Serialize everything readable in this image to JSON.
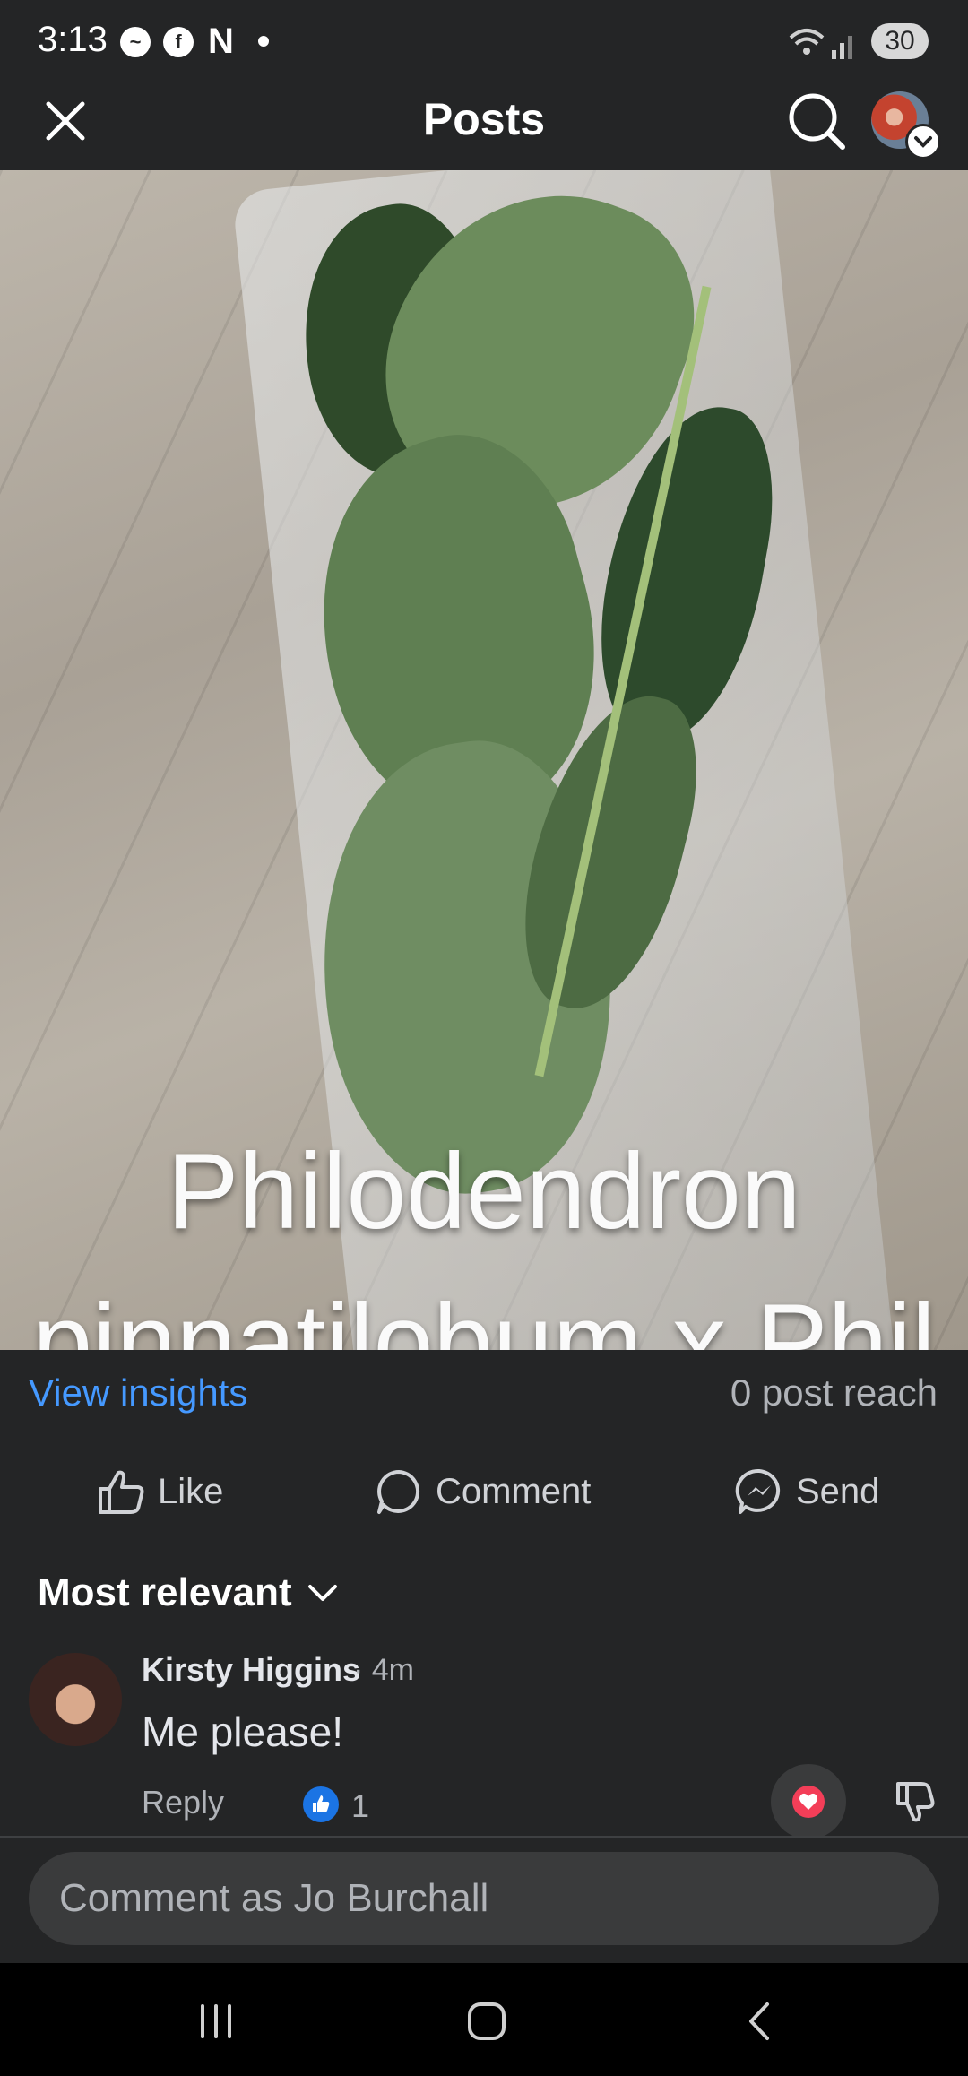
{
  "status_bar": {
    "time": "3:13",
    "battery": "30",
    "app_icons": [
      "messenger-icon",
      "facebook-icon",
      "netflix-icon",
      "dot-icon"
    ]
  },
  "header": {
    "title": "Posts",
    "close_icon": "close-icon",
    "search_icon": "search-icon"
  },
  "photo": {
    "caption_line1": "Philodendron",
    "caption_line2": "pinnatilobum x Phil"
  },
  "insights": {
    "link": "View insights",
    "reach": "0 post reach"
  },
  "actions": {
    "like": "Like",
    "comment": "Comment",
    "send": "Send"
  },
  "comments": {
    "sort_label": "Most relevant",
    "items": [
      {
        "author": "Kirsty Higgins",
        "time": "· 4m",
        "text": "Me please!",
        "reply_label": "Reply",
        "like_count": "1"
      }
    ]
  },
  "composer": {
    "placeholder": "Comment as Jo Burchall"
  },
  "colors": {
    "link_blue": "#4599ff",
    "like_blue": "#1b74e4",
    "heart_red": "#f33e58",
    "background": "#242526"
  }
}
